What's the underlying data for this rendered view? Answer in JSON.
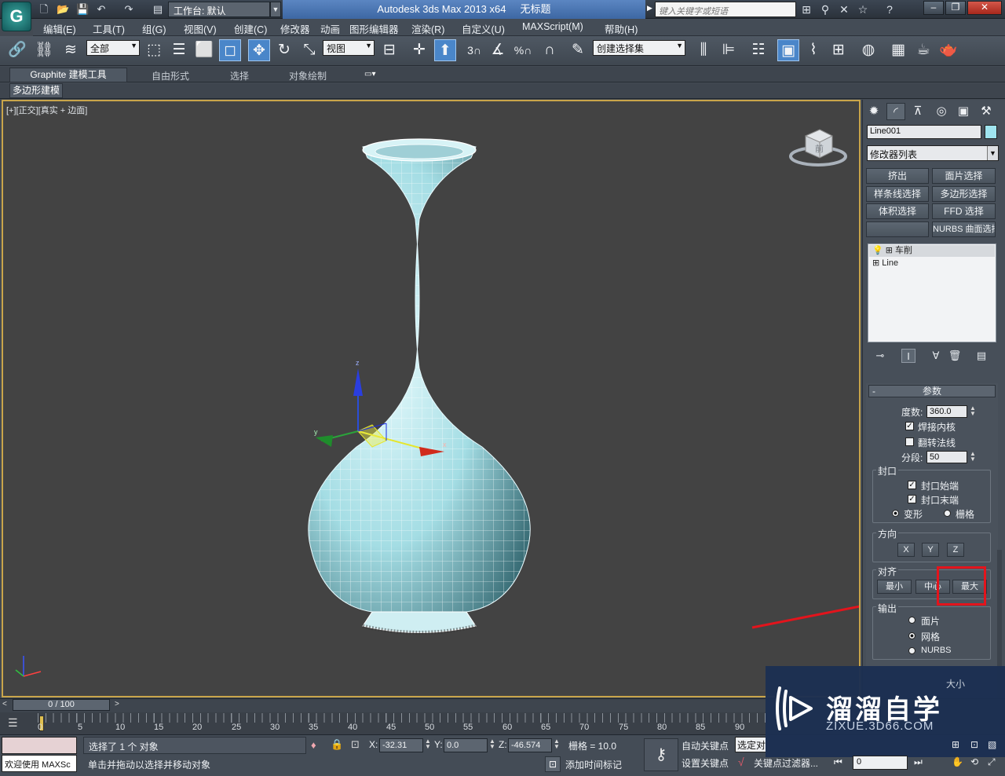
{
  "titlebar": {
    "app_title": "Autodesk 3ds Max  2013 x64",
    "doc_title": "无标题",
    "workspace": "工作台: 默认",
    "search_placeholder": "键入关键字或短语"
  },
  "menu": [
    "编辑(E)",
    "工具(T)",
    "组(G)",
    "视图(V)",
    "创建(C)",
    "修改器",
    "动画",
    "图形编辑器",
    "渲染(R)",
    "自定义(U)",
    "MAXScript(M)",
    "帮助(H)"
  ],
  "toolbar": {
    "selection_filter": "全部",
    "ref_coord": "视图",
    "named_selection": "创建选择集",
    "snap_labels": [
      "3",
      "%"
    ]
  },
  "ribbon": {
    "tabs": [
      "Graphite 建模工具",
      "自由形式",
      "选择",
      "对象绘制"
    ],
    "active_tab": "Graphite 建模工具",
    "subtab": "多边形建模"
  },
  "viewport": {
    "label_plus": "[+]",
    "label_view": "[正交]",
    "label_shading": "[真实 + 边面]",
    "viewcube_label": "前",
    "gizmo_axes": [
      "x",
      "y",
      "z"
    ]
  },
  "command_panel": {
    "object_name": "Line001",
    "object_color": "#9fe4ef",
    "modifier_list": "修改器列表",
    "modifier_buttons": [
      "挤出",
      "面片选择",
      "样条线选择",
      "多边形选择",
      "体积选择",
      "FFD 选择",
      "NURBS 曲面选择"
    ],
    "stack": [
      "车削",
      "Line"
    ],
    "params_title": "参数",
    "degrees_label": "度数:",
    "degrees_value": "360.0",
    "weld_core": "焊接内核",
    "weld_core_checked": true,
    "flip_normals": "翻转法线",
    "flip_normals_checked": false,
    "segments_label": "分段:",
    "segments_value": "50",
    "capping_title": "封口",
    "cap_start": "封口始端",
    "cap_end": "封口末端",
    "morph": "变形",
    "grid": "栅格",
    "direction_title": "方向",
    "dir_buttons": [
      "X",
      "Y",
      "Z"
    ],
    "align_title": "对齐",
    "align_buttons": [
      "最小",
      "中心",
      "最大"
    ],
    "output_title": "输出",
    "output_options": [
      "面片",
      "网格",
      "NURBS"
    ],
    "output_selected": "网格",
    "extra_text": "大小"
  },
  "timeline": {
    "slider": "0 / 100",
    "ticks": [
      "0",
      "5",
      "10",
      "15",
      "20",
      "25",
      "30",
      "35",
      "40",
      "45",
      "50",
      "55",
      "60",
      "65",
      "70",
      "75",
      "80",
      "85",
      "90"
    ]
  },
  "status": {
    "welcome": "欢迎使用 MAXSc",
    "selected": "选择了 1 个 对象",
    "prompt": "单击并拖动以选择并移动对象",
    "x_label": "X:",
    "x_value": "-32.31",
    "y_label": "Y:",
    "y_value": "0.0",
    "z_label": "Z:",
    "z_value": "-46.574",
    "grid": "栅格 = 10.0",
    "add_time_tag": "添加时间标记",
    "auto_key": "自动关键点",
    "set_key": "设置关键点",
    "selected_obj": "选定对",
    "key_filter": "关键点过滤器...",
    "frame": "0"
  },
  "watermark": {
    "brand": "溜溜自学",
    "url": "ZIXUE.3D66.COM"
  }
}
